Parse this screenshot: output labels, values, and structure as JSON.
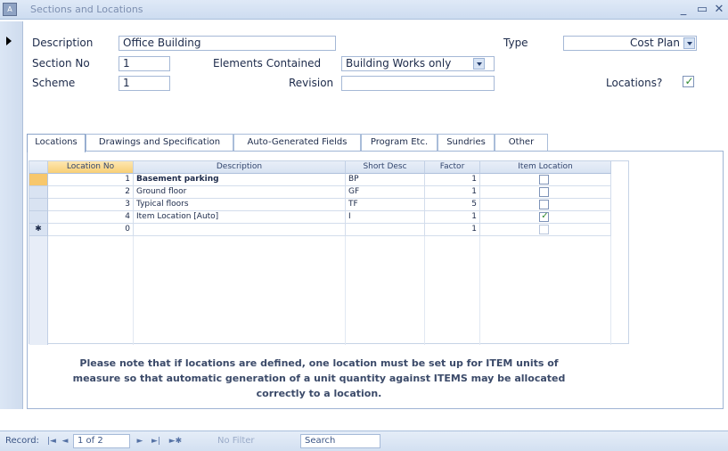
{
  "window": {
    "icon_label": "A",
    "title": "Sections and Locations",
    "minimize_glyph": "_",
    "restore_glyph": "▭",
    "close_glyph": "✕"
  },
  "form": {
    "description_label": "Description",
    "description_value": "Office Building",
    "section_no_label": "Section No",
    "section_no_value": "1",
    "scheme_label": "Scheme",
    "scheme_value": "1",
    "elements_contained_label": "Elements Contained",
    "elements_contained_value": "Building Works only",
    "revision_label": "Revision",
    "revision_value": "",
    "type_label": "Type",
    "type_value": "Cost Plan",
    "locations_label": "Locations?",
    "locations_checked": true
  },
  "tabs": [
    {
      "label": "Locations",
      "active": true
    },
    {
      "label": "Drawings and Specification",
      "active": false
    },
    {
      "label": "Auto-Generated Fields",
      "active": false
    },
    {
      "label": "Program Etc.",
      "active": false
    },
    {
      "label": "Sundries",
      "active": false
    },
    {
      "label": "Other",
      "active": false
    }
  ],
  "grid": {
    "columns": [
      "Location No",
      "Description",
      "Short Desc",
      "Factor",
      "Item Location"
    ],
    "rows": [
      {
        "selector": "",
        "location_no": "1",
        "description": "Basement parking",
        "short_desc": "BP",
        "factor": "1",
        "item_location": false,
        "current": true
      },
      {
        "selector": "",
        "location_no": "2",
        "description": "Ground floor",
        "short_desc": "GF",
        "factor": "1",
        "item_location": false,
        "current": false
      },
      {
        "selector": "",
        "location_no": "3",
        "description": "Typical floors",
        "short_desc": "TF",
        "factor": "5",
        "item_location": false,
        "current": false
      },
      {
        "selector": "",
        "location_no": "4",
        "description": "Item Location [Auto]",
        "short_desc": "I",
        "factor": "1",
        "item_location": true,
        "current": false
      },
      {
        "selector": "✱",
        "location_no": "0",
        "description": "",
        "short_desc": "",
        "factor": "1",
        "item_location": false,
        "current": false
      }
    ]
  },
  "note": {
    "line1": "Please note that if locations are defined, one location must be set up for ITEM units of",
    "line2": "measure so that automatic generation of a unit quantity against ITEMS may be allocated",
    "line3": "correctly to a location."
  },
  "statusbar": {
    "record_label": "Record:",
    "first_glyph": "|◄",
    "prev_glyph": "◄",
    "position": "1 of 2",
    "next_glyph": "►",
    "last_glyph": "►|",
    "new_glyph": "►✱",
    "filter_label": "No Filter",
    "search_label": "Search"
  },
  "colors": {
    "accent": "#cddcf0",
    "check_green": "#2f8a2f",
    "current_row": "#f7c76c"
  }
}
